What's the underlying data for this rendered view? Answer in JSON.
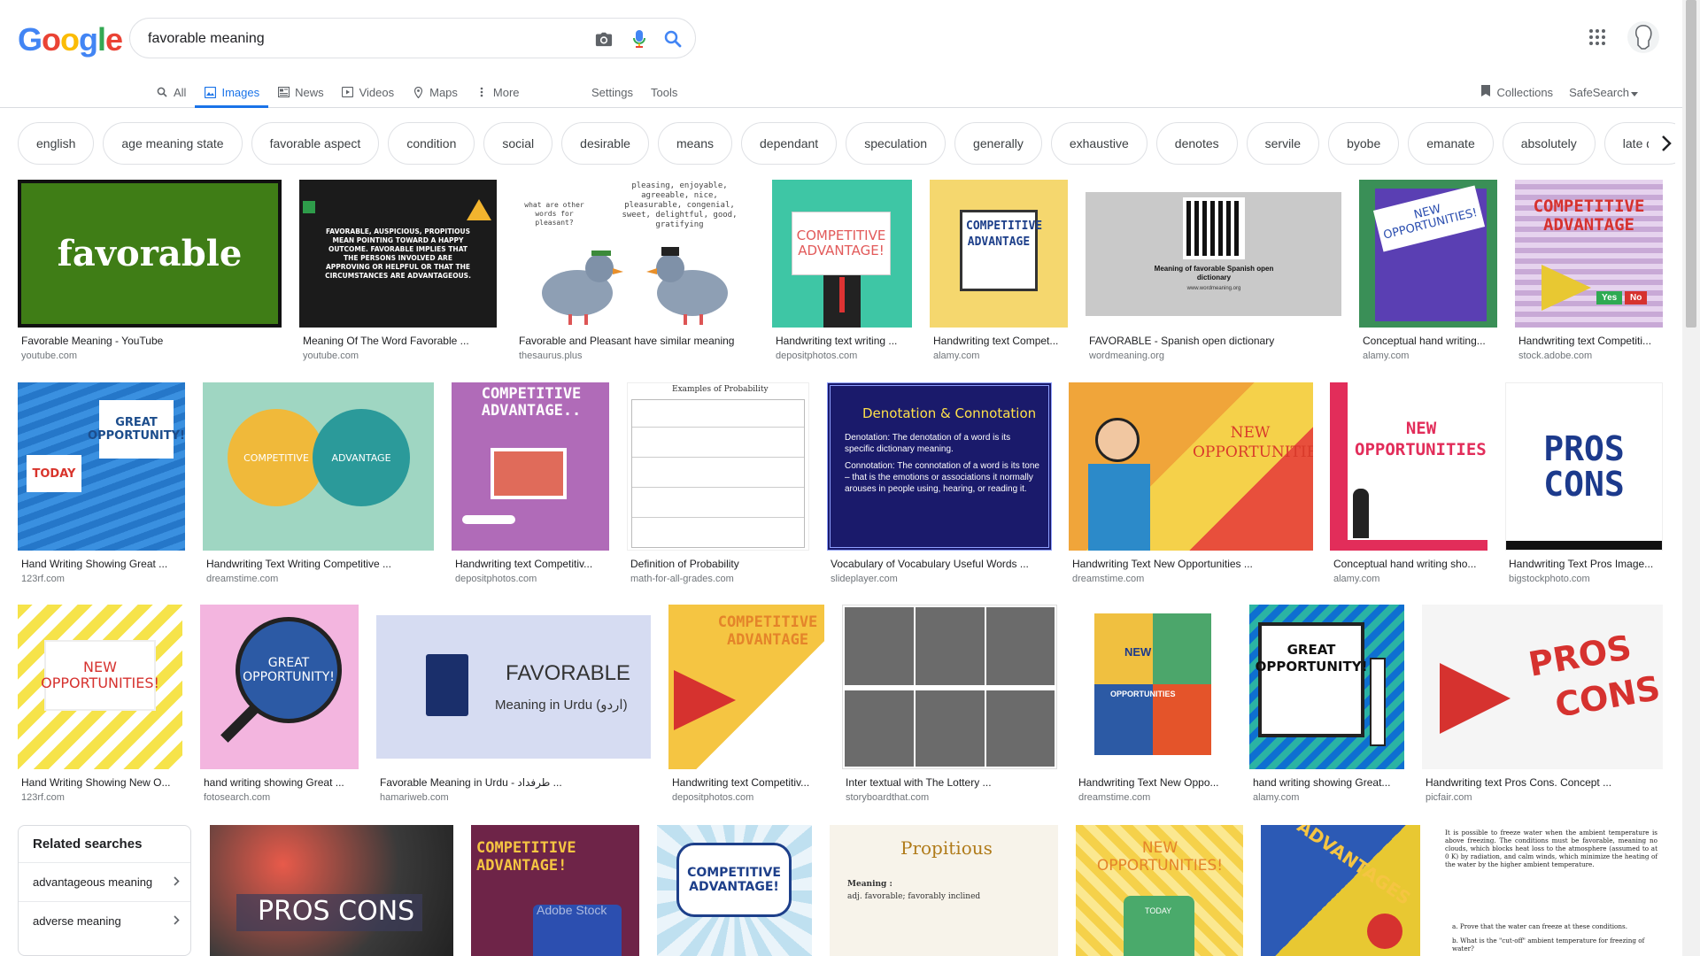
{
  "logo": [
    "G",
    "o",
    "o",
    "g",
    "l",
    "e"
  ],
  "logo_colors": [
    "#4285f4",
    "#ea4335",
    "#fbbc05",
    "#4285f4",
    "#34a853",
    "#ea4335"
  ],
  "search": {
    "value": "favorable meaning"
  },
  "tabs": [
    {
      "label": "All",
      "icon": "search-icon"
    },
    {
      "label": "Images",
      "icon": "image-icon",
      "active": true
    },
    {
      "label": "News",
      "icon": "news-icon"
    },
    {
      "label": "Videos",
      "icon": "video-icon"
    },
    {
      "label": "Maps",
      "icon": "map-pin-icon"
    },
    {
      "label": "More",
      "icon": "more-vert-icon"
    }
  ],
  "tools": {
    "settings": "Settings",
    "tools": "Tools"
  },
  "right": {
    "collections": "Collections",
    "safesearch": "SafeSearch"
  },
  "chips": [
    "english",
    "age meaning state",
    "favorable aspect",
    "condition",
    "social",
    "desirable",
    "means",
    "dependant",
    "speculation",
    "generally",
    "exhaustive",
    "denotes",
    "servile",
    "byobe",
    "emanate",
    "absolutely",
    "late date"
  ],
  "results": [
    {
      "title": "Favorable Meaning - YouTube",
      "source": "youtube.com",
      "text": "favorable"
    },
    {
      "title": "Meaning Of The Word Favorable ...",
      "source": "youtube.com",
      "text": "FAVORABLE, AUSPICIOUS, PROPITIOUS MEAN POINTING TOWARD A HAPPY OUTCOME. FAVORABLE IMPLIES THAT THE PERSONS INVOLVED ARE APPROVING OR HELPFUL OR THAT THE CIRCUMSTANCES ARE ADVANTAGEOUS."
    },
    {
      "title": "Favorable and Pleasant have similar meaning",
      "source": "thesaurus.plus",
      "text": "pleasing, enjoyable, agreeable, nice, pleasurable, congenial, sweet, delightful, good, gratifying",
      "text2": "what are other words for pleasant?"
    },
    {
      "title": "Handwriting text writing ...",
      "source": "depositphotos.com",
      "text": "COMPETITIVE ADVANTAGE!"
    },
    {
      "title": "Handwriting text Compet...",
      "source": "alamy.com",
      "text": "COMPETITIVE ADVANTAGE"
    },
    {
      "title": "FAVORABLE - Spanish open dictionary",
      "source": "wordmeaning.org",
      "text": "Meaning of favorable Spanish open dictionary",
      "text2": "www.wordmeaning.org"
    },
    {
      "title": "Conceptual hand writing...",
      "source": "alamy.com",
      "text": "NEW OPPORTUNITIES!"
    },
    {
      "title": "Handwriting text Competiti...",
      "source": "stock.adobe.com",
      "text": "COMPETITIVE ADVANTAGE",
      "text2": "Yes",
      "text3": "No"
    },
    {
      "title": "Hand Writing Showing Great ...",
      "source": "123rf.com",
      "text": "GREAT OPPORTUNITY!",
      "text2": "TODAY"
    },
    {
      "title": "Handwriting Text Writing Competitive ...",
      "source": "dreamstime.com",
      "text": "COMPETITIVE",
      "text2": "ADVANTAGE"
    },
    {
      "title": "Handwriting text Competitiv...",
      "source": "depositphotos.com",
      "text": "COMPETITIVE ADVANTAGE.."
    },
    {
      "title": "Definition of Probability",
      "source": "math-for-all-grades.com",
      "text": "Examples of Probability"
    },
    {
      "title": "Vocabulary of Vocabulary Useful Words ...",
      "source": "slideplayer.com",
      "text": "Denotation & Connotation",
      "text2": "Denotation: The denotation of a word is its specific dictionary meaning.",
      "text3": "Connotation: The connotation of a word is its tone – that is the emotions or associations it normally arouses in people using, hearing, or reading it."
    },
    {
      "title": "Handwriting Text New Opportunities ...",
      "source": "dreamstime.com",
      "text": "NEW OPPORTUNITIES!"
    },
    {
      "title": "Conceptual hand writing sho...",
      "source": "alamy.com",
      "text": "NEW OPPORTUNITIES!"
    },
    {
      "title": "Handwriting Text Pros Image...",
      "source": "bigstockphoto.com",
      "text": "PROS",
      "text2": "CONS"
    },
    {
      "title": "Hand Writing Showing New O...",
      "source": "123rf.com",
      "text": "NEW OPPORTUNITIES!"
    },
    {
      "title": "hand writing showing Great ...",
      "source": "fotosearch.com",
      "text": "GREAT OPPORTUNITY!"
    },
    {
      "title": "Favorable Meaning in Urdu - طرفداد ...",
      "source": "hamariweb.com",
      "text": "FAVORABLE",
      "text2": "Meaning in Urdu (اردو)"
    },
    {
      "title": "Handwriting text Competitiv...",
      "source": "depositphotos.com",
      "text": "COMPETITIVE ADVANTAGE"
    },
    {
      "title": "Inter textual with The Lottery ...",
      "source": "storyboardthat.com"
    },
    {
      "title": "Handwriting Text New Oppo...",
      "source": "dreamstime.com",
      "text": "NEW",
      "text2": "OPPORTUNITIES"
    },
    {
      "title": "hand writing showing Great...",
      "source": "alamy.com",
      "text": "GREAT OPPORTUNITY!"
    },
    {
      "title": "Handwriting text Pros Cons. Concept ...",
      "source": "picfair.com",
      "text": "PROS",
      "text2": "CONS"
    }
  ],
  "bottom_row": [
    {
      "text": "PROS  CONS"
    },
    {
      "text": "COMPETITIVE ADVANTAGE!",
      "text2": "Adobe Stock"
    },
    {
      "text": "COMPETITIVE ADVANTAGE!"
    },
    {
      "text": "Propitious",
      "text2": "Meaning :",
      "text3": "adj. favorable; favorably inclined"
    },
    {
      "text": "NEW OPPORTUNITIES!",
      "text2": "TODAY"
    },
    {
      "text": "ADVANTAGES"
    },
    {
      "text": "It is possible to freeze water when the ambient temperature is above freezing. The conditions must be favorable, meaning no clouds, which blocks heat loss to the atmosphere (assumed to at 0 K) by radiation, and calm winds, which minimize the heating of the water by the higher ambient temperature.",
      "text2": "a.  Prove that the water can freeze at these conditions.",
      "text3": "b.  What is the \"cut-off\" ambient temperature for freezing of water?"
    }
  ],
  "related": {
    "title": "Related searches",
    "items": [
      "advantageous meaning",
      "adverse meaning"
    ]
  },
  "colors": {
    "accent": "#1a73e8",
    "muted": "#5f6368",
    "border": "#dfe1e5"
  }
}
